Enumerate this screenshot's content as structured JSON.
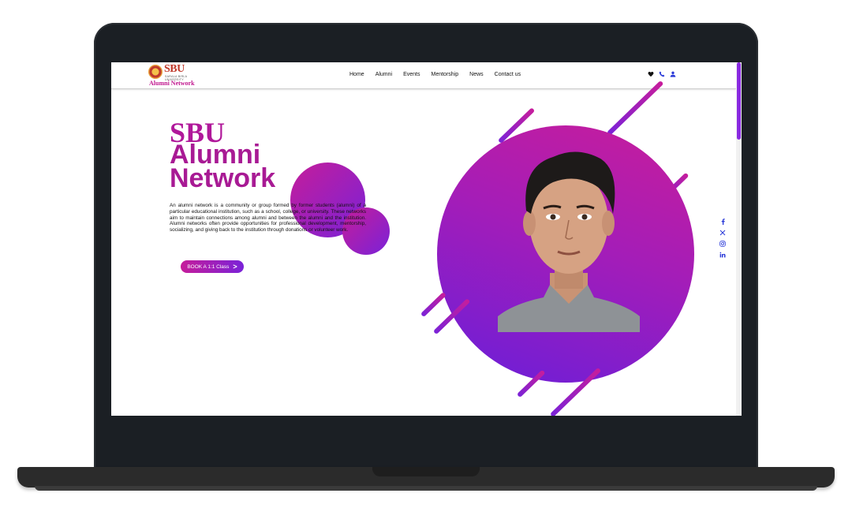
{
  "logo": {
    "brand": "SBU",
    "sub": "SARALA BIRLA UNIVERSITY",
    "tagline": "Alumni Network"
  },
  "nav": {
    "items": [
      "Home",
      "Alumni",
      "Events",
      "Mentorship",
      "News",
      "Contact us"
    ]
  },
  "header_icons": [
    "heart-icon",
    "phone-icon",
    "user-icon"
  ],
  "hero": {
    "title_line1": "SBU",
    "title_line2": "Alumni",
    "title_line3": "Network",
    "description": "An alumni network is a community or group formed by former students (alumni) of a particular educational institution, such as a school, college, or university. These networks aim to maintain connections among alumni and between the alumni and the institution. Alumni networks often provide opportunities for professional development, mentorship, socializing, and giving back to the institution through donations or volunteer work.",
    "cta_label": "BOOK A 1:1 Class",
    "cta_arrow": ">"
  },
  "social": [
    "facebook-icon",
    "x-icon",
    "instagram-icon",
    "linkedin-icon"
  ],
  "colors": {
    "accent_magenta": "#c51d9a",
    "accent_purple": "#7a22d8",
    "title_color": "#a81a94",
    "frame": "#1b1f24",
    "icon_blue": "#2a3ad8"
  }
}
